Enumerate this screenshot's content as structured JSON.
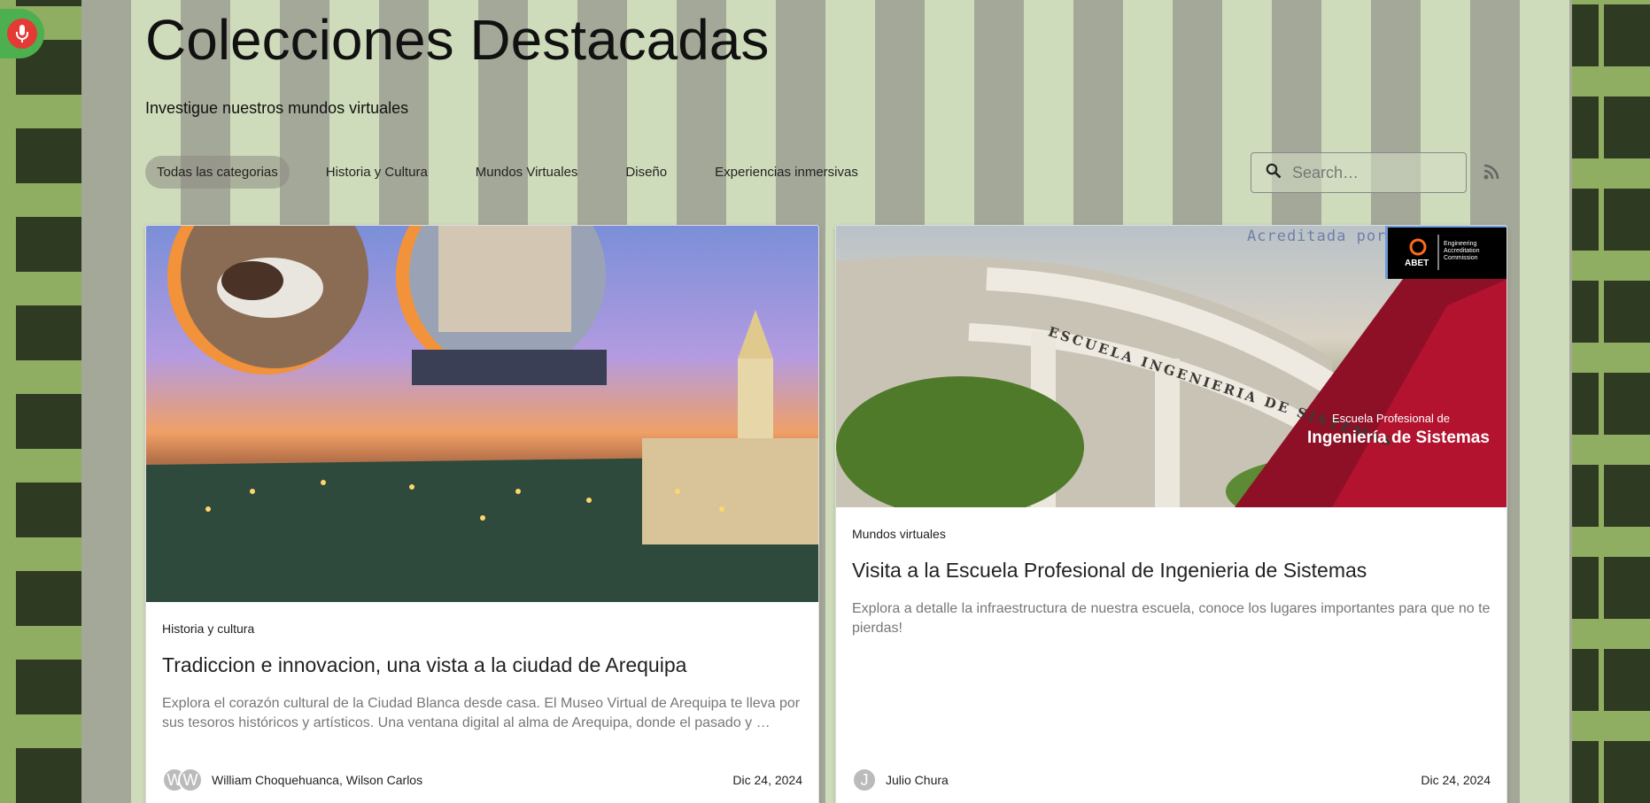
{
  "header": {
    "title": "Colecciones Destacadas",
    "subtitle": "Investigue nuestros mundos virtuales"
  },
  "filters": [
    {
      "label": "Todas las categorias",
      "active": true
    },
    {
      "label": "Historia y Cultura",
      "active": false
    },
    {
      "label": "Mundos Virtuales",
      "active": false
    },
    {
      "label": "Diseño",
      "active": false
    },
    {
      "label": "Experiencias inmersivas",
      "active": false
    }
  ],
  "search": {
    "placeholder": "Search…"
  },
  "icons": {
    "mic": "microphone-icon",
    "search": "search-icon",
    "rss": "rss-icon"
  },
  "colors": {
    "mic_bg": "#4caf50",
    "mic_button": "#e53935",
    "accent_red": "#a3122e"
  },
  "cards": [
    {
      "category": "Historia y cultura",
      "title": "Tradiccion e innovacion, una vista a la ciudad de Arequipa",
      "description": "Explora el corazón cultural de la Ciudad Blanca desde casa. El Museo Virtual de Arequipa te lleva por sus tesoros históricos y artísticos. Una ventana digital al alma de Arequipa, donde el pasado y …",
      "avatars": [
        "W",
        "W"
      ],
      "authors": "William Choquehuanca, Wilson Carlos",
      "date": "Dic 24, 2024"
    },
    {
      "category": "Mundos virtuales",
      "title": "Visita a la Escuela Profesional de Ingenieria de Sistemas",
      "description": "Explora a detalle la infraestructura de nuestra escuela, conoce los lugares importantes para que no te pierdas!",
      "avatars": [
        "J"
      ],
      "authors": "Julio Chura",
      "date": "Dic 24, 2024",
      "image_text": {
        "accredited": "Acreditada por",
        "abet": "ABET",
        "abet_sub": [
          "Engineering",
          "Accreditation",
          "Commission"
        ],
        "banner_small": "Escuela Profesional de",
        "banner_big": "Ingeniería de Sistemas",
        "building_sign": "ESCUELA INGENIERIA DE SISTEMAS"
      }
    }
  ]
}
